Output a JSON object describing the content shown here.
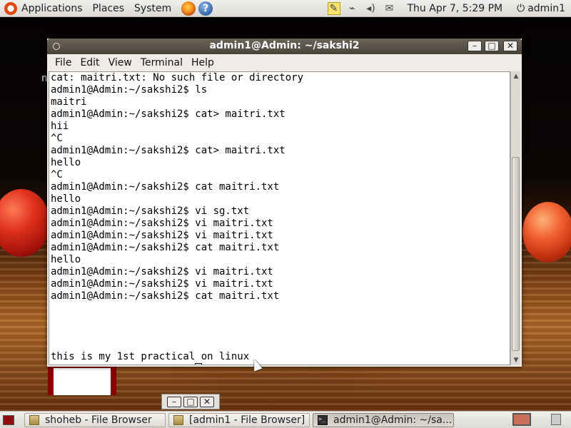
{
  "top_panel": {
    "menus": [
      "Applications",
      "Places",
      "System"
    ],
    "clock": "Thu Apr  7,  5:29 PM",
    "user": "admin1"
  },
  "desktop": {
    "stray_text": "n"
  },
  "terminal": {
    "title": "admin1@Admin: ~/sakshi2",
    "menus": [
      "File",
      "Edit",
      "View",
      "Terminal",
      "Help"
    ],
    "lines": [
      "cat: maitri.txt: No such file or directory",
      "admin1@Admin:~/sakshi2$ ls",
      "maitri",
      "admin1@Admin:~/sakshi2$ cat> maitri.txt",
      "hii",
      "^C",
      "admin1@Admin:~/sakshi2$ cat> maitri.txt",
      "hello",
      "^C",
      "admin1@Admin:~/sakshi2$ cat maitri.txt",
      "hello",
      "admin1@Admin:~/sakshi2$ vi sg.txt",
      "admin1@Admin:~/sakshi2$ vi maitri.txt",
      "admin1@Admin:~/sakshi2$ vi maitri.txt",
      "admin1@Admin:~/sakshi2$ cat maitri.txt",
      "hello",
      "admin1@Admin:~/sakshi2$ vi maitri.txt",
      "admin1@Admin:~/sakshi2$ vi maitri.txt",
      "admin1@Admin:~/sakshi2$ cat maitri.txt",
      "",
      "",
      "",
      "",
      "this is my 1st practical on linux"
    ],
    "prompt": "admin1@Admin:~/sakshi2$ "
  },
  "taskbar": {
    "tasks": [
      {
        "label": "shoheb - File Browser",
        "icon": "folder-icon",
        "active": false
      },
      {
        "label": "[admin1 - File Browser]",
        "icon": "folder-icon",
        "active": false
      },
      {
        "label": "admin1@Admin: ~/sa...",
        "icon": "terminal-icon",
        "active": true
      }
    ]
  },
  "colors": {
    "titlebar": "#4a443c",
    "panel": "#dcdad5",
    "terminal_bg": "#ffffff"
  }
}
